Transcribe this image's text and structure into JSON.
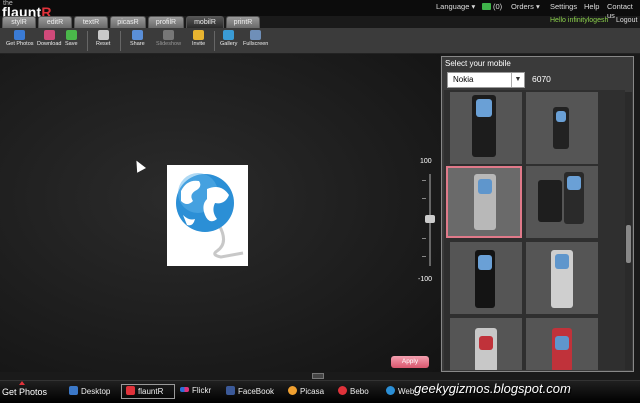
{
  "app": {
    "logo_prefix": "the",
    "logo_main": "flaunt",
    "logo_r": "R"
  },
  "topnav": {
    "language": "Language ▾",
    "cart": "(0)",
    "orders": "Orders ▾",
    "settings": "Settings",
    "help": "Help",
    "contact": "Contact us",
    "hello": "Hello infinitylogesh",
    "logout": "Logout"
  },
  "tabs": [
    "stylR",
    "editR",
    "textR",
    "picasR",
    "profilR",
    "mobilR",
    "printR"
  ],
  "active_tab": "mobilR",
  "toolbar": {
    "get_photos": "Get Photos",
    "download": "Download",
    "save": "Save",
    "reset": "Reset",
    "share": "Share",
    "slideshow": "Slideshow",
    "invite": "Invite",
    "gallery": "Gallery",
    "fullscreen": "Fullscreen"
  },
  "slider": {
    "max_label": "100",
    "min_label": "-100",
    "level_percent": 50
  },
  "mobile_panel": {
    "title": "Select your mobile",
    "brand": "Nokia",
    "model_number": "6070"
  },
  "apply_label": "Apply",
  "bottom": {
    "get_photos": "Get Photos",
    "desktop": "Desktop",
    "flauntr": "flauntR",
    "flickr": "Flickr",
    "facebook": "FaceBook",
    "picasa": "Picasa",
    "bebo": "Bebo",
    "web": "Web"
  },
  "watermark": "geekygizmos.blogspot.com",
  "colors": {
    "brand_red": "#e0323a",
    "hello_green": "#8bd14b",
    "selection_pink": "#e07a8a",
    "globe_blue": "#2b8fd6"
  }
}
